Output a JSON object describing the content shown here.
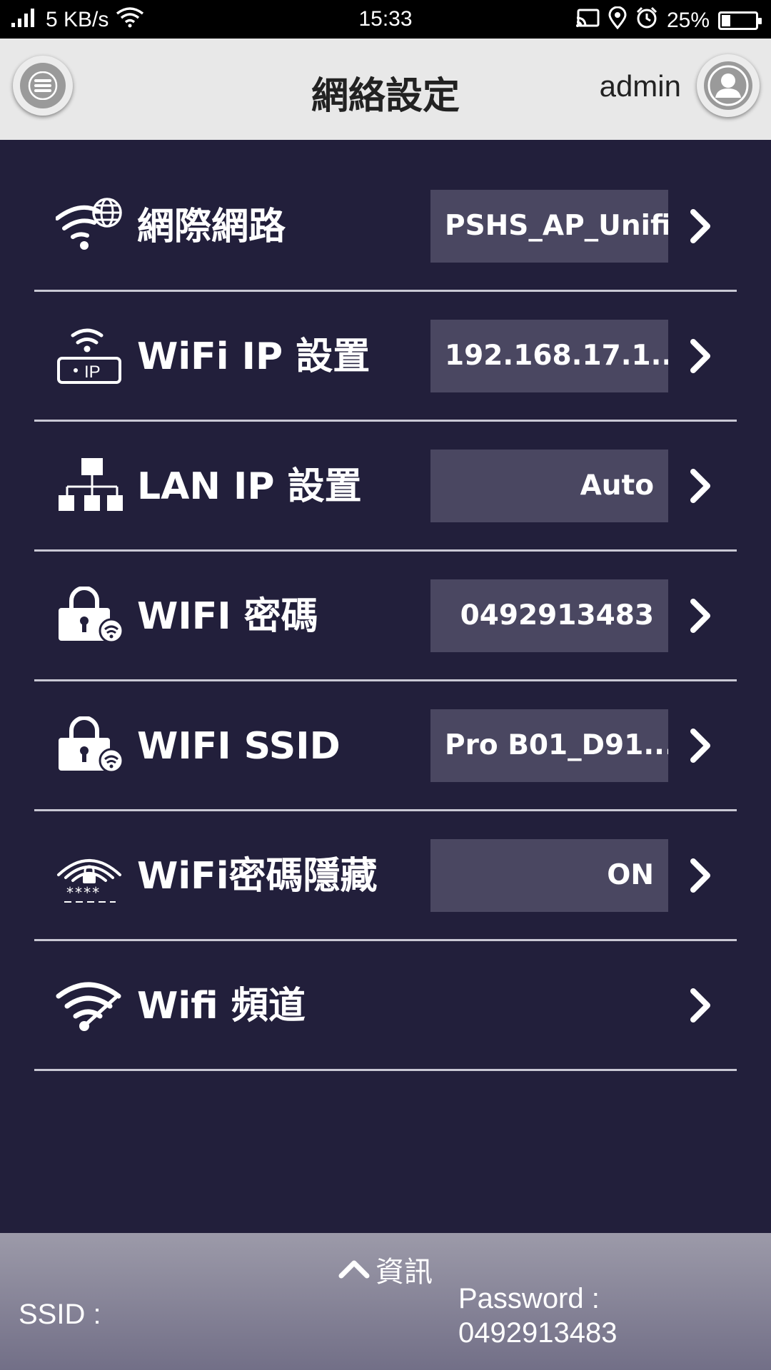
{
  "status_bar": {
    "net_speed": "5 KB/s",
    "time": "15:33",
    "battery_percent": "25%",
    "battery_level": 0.25
  },
  "header": {
    "title": "網絡設定",
    "user": "admin"
  },
  "settings": [
    {
      "label": "網際網路",
      "value": "PSHS_AP_Unifi",
      "icon": "wifi-globe-icon"
    },
    {
      "label": "WiFi IP 設置",
      "value": "192.168.17.1...",
      "icon": "wifi-ip-icon"
    },
    {
      "label": "LAN IP 設置",
      "value": "Auto",
      "icon": "lan-network-icon"
    },
    {
      "label": "WIFI 密碼",
      "value": "0492913483",
      "icon": "lock-wifi-icon"
    },
    {
      "label": "WIFI SSID",
      "value": "Pro B01_D91...",
      "icon": "lock-wifi-icon"
    },
    {
      "label": "WiFi密碼隱藏",
      "value": "ON",
      "icon": "wifi-hidden-password-icon"
    },
    {
      "label": "Wifi 頻道",
      "value": "",
      "icon": "wifi-channel-icon"
    }
  ],
  "info_panel": {
    "toggle_label": "資訊",
    "ssid_label": "SSID :",
    "password_label": "Password :",
    "password_value": "0492913483"
  },
  "colors": {
    "background": "#221f3b",
    "value_box": "#4a4761",
    "header_bg": "#e8e8e8"
  }
}
